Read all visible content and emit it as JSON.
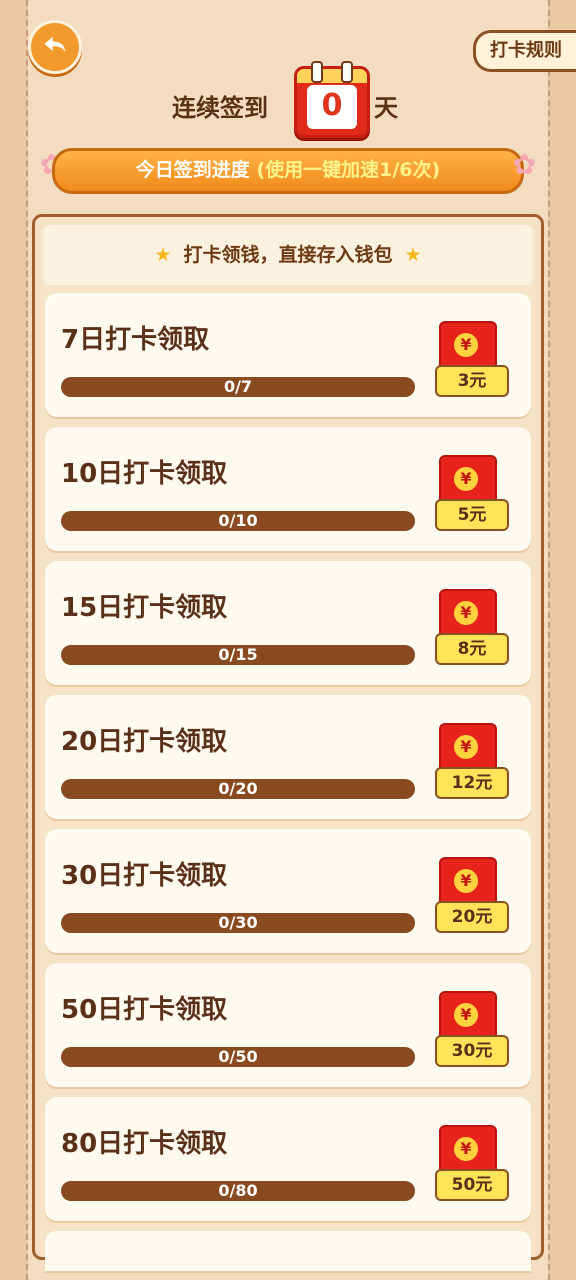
{
  "header": {
    "rules_label": "打卡规则"
  },
  "streak": {
    "prefix": "连续签到",
    "days": "0",
    "suffix": "天"
  },
  "banner": {
    "text": "今日签到进度",
    "highlight": "(使用一键加速1/6次)"
  },
  "panel": {
    "heading": "打卡领钱，直接存入钱包"
  },
  "rewards": [
    {
      "title": "7日打卡领取",
      "progress": "0/7",
      "amount": "3元"
    },
    {
      "title": "10日打卡领取",
      "progress": "0/10",
      "amount": "5元"
    },
    {
      "title": "15日打卡领取",
      "progress": "0/15",
      "amount": "8元"
    },
    {
      "title": "20日打卡领取",
      "progress": "0/20",
      "amount": "12元"
    },
    {
      "title": "30日打卡领取",
      "progress": "0/30",
      "amount": "20元"
    },
    {
      "title": "50日打卡领取",
      "progress": "0/50",
      "amount": "30元"
    },
    {
      "title": "80日打卡领取",
      "progress": "0/80",
      "amount": "50元"
    }
  ],
  "icons": {
    "back": "back-arrow-icon",
    "star": "star-icon",
    "redpack": "red-envelope-icon",
    "calendar": "calendar-icon",
    "flower": "flower-icon"
  },
  "colors": {
    "accent": "#f08a1b",
    "brown": "#8a4a1f",
    "red": "#e8231c"
  }
}
